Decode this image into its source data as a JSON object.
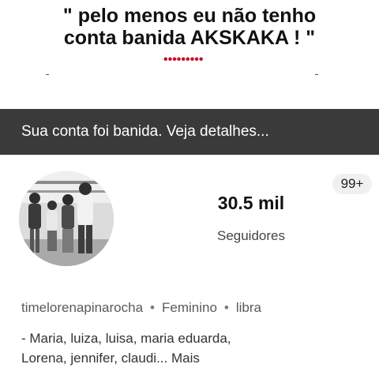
{
  "caption": {
    "line1": "\" pelo menos eu não tenho",
    "line2": "conta banida AKSKAKA ! \"",
    "dots": "•••••••••"
  },
  "banner": {
    "text": "Sua conta foi banida. Veja detalhes..."
  },
  "notifications": {
    "badge": "99+"
  },
  "profile": {
    "followers_count": "30.5 mil",
    "followers_label": "Seguidores",
    "username": "timelorenapinarocha",
    "gender": "Feminino",
    "sign": "libra",
    "separator": "•",
    "bio_line1": "- Maria, luiza, luisa, maria eduarda,",
    "bio_line2": "Lorena, jennifer, claudi... Mais"
  },
  "colors": {
    "banner_bg": "#3a3a3a",
    "dots": "#c8102e"
  }
}
